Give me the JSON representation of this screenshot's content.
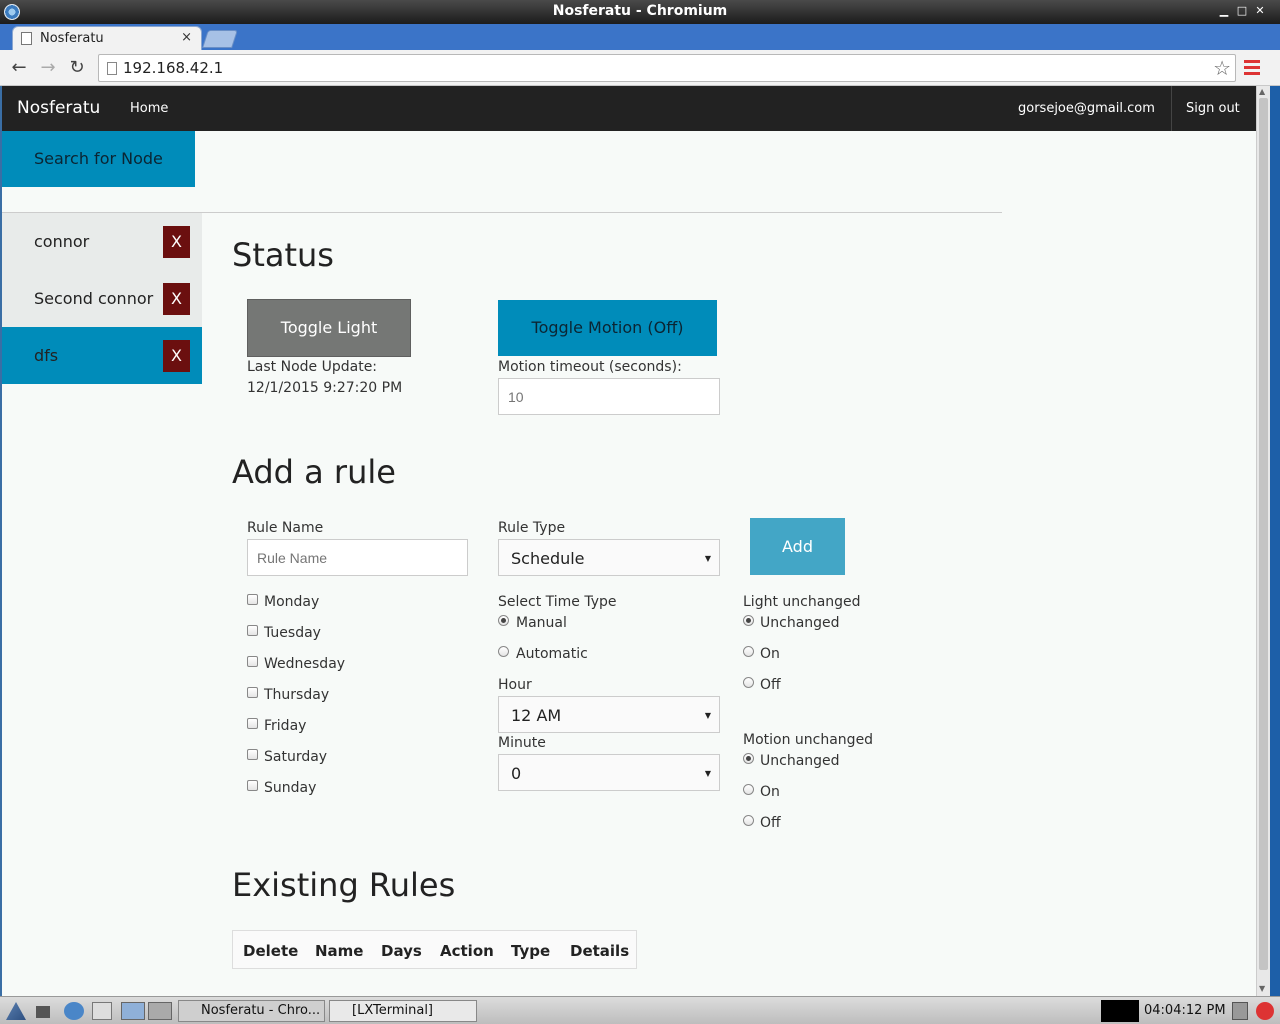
{
  "window": {
    "title": "Nosferatu - Chromium",
    "min": "▁",
    "max": "□",
    "close": "✕"
  },
  "browser": {
    "tab_title": "Nosferatu",
    "tab_close": "×",
    "back": "←",
    "forward": "→",
    "reload": "↻",
    "url": "192.168.42.1",
    "star": "☆"
  },
  "navbar": {
    "brand": "Nosferatu",
    "home": "Home",
    "email": "gorsejoe@gmail.com",
    "signout": "Sign out"
  },
  "search_button": "Search for Node",
  "nodes": [
    {
      "label": "connor",
      "remove": "X",
      "active": false
    },
    {
      "label": "Second connor",
      "remove": "X",
      "active": false
    },
    {
      "label": "dfs",
      "remove": "X",
      "active": true
    }
  ],
  "status": {
    "heading": "Status",
    "toggle_light": "Toggle Light",
    "toggle_motion": "Toggle Motion (Off)",
    "last_update_label": "Last Node Update:",
    "last_update_value": "12/1/2015 9:27:20 PM",
    "motion_timeout_label": "Motion timeout (seconds):",
    "motion_timeout_placeholder": "10"
  },
  "add_rule": {
    "heading": "Add a rule",
    "rule_name_label": "Rule Name",
    "rule_name_placeholder": "Rule Name",
    "rule_type_label": "Rule Type",
    "rule_type_value": "Schedule",
    "add_button": "Add",
    "days": [
      "Monday",
      "Tuesday",
      "Wednesday",
      "Thursday",
      "Friday",
      "Saturday",
      "Sunday"
    ],
    "time_type_label": "Select Time Type",
    "time_types": [
      {
        "label": "Manual",
        "selected": true
      },
      {
        "label": "Automatic",
        "selected": false
      }
    ],
    "hour_label": "Hour",
    "hour_value": "12 AM",
    "minute_label": "Minute",
    "minute_value": "0",
    "light_label": "Light unchanged",
    "light_options": [
      {
        "label": "Unchanged",
        "selected": true
      },
      {
        "label": "On",
        "selected": false
      },
      {
        "label": "Off",
        "selected": false
      }
    ],
    "motion_label": "Motion unchanged",
    "motion_options": [
      {
        "label": "Unchanged",
        "selected": true
      },
      {
        "label": "On",
        "selected": false
      },
      {
        "label": "Off",
        "selected": false
      }
    ],
    "caret": "▼"
  },
  "existing_rules": {
    "heading": "Existing Rules",
    "columns": [
      "Delete",
      "Name",
      "Days",
      "Action",
      "Type",
      "Details"
    ]
  },
  "taskbar": {
    "tasks": [
      "Nosferatu - Chro...",
      "[LXTerminal]"
    ],
    "clock": "04:04:12 PM"
  }
}
